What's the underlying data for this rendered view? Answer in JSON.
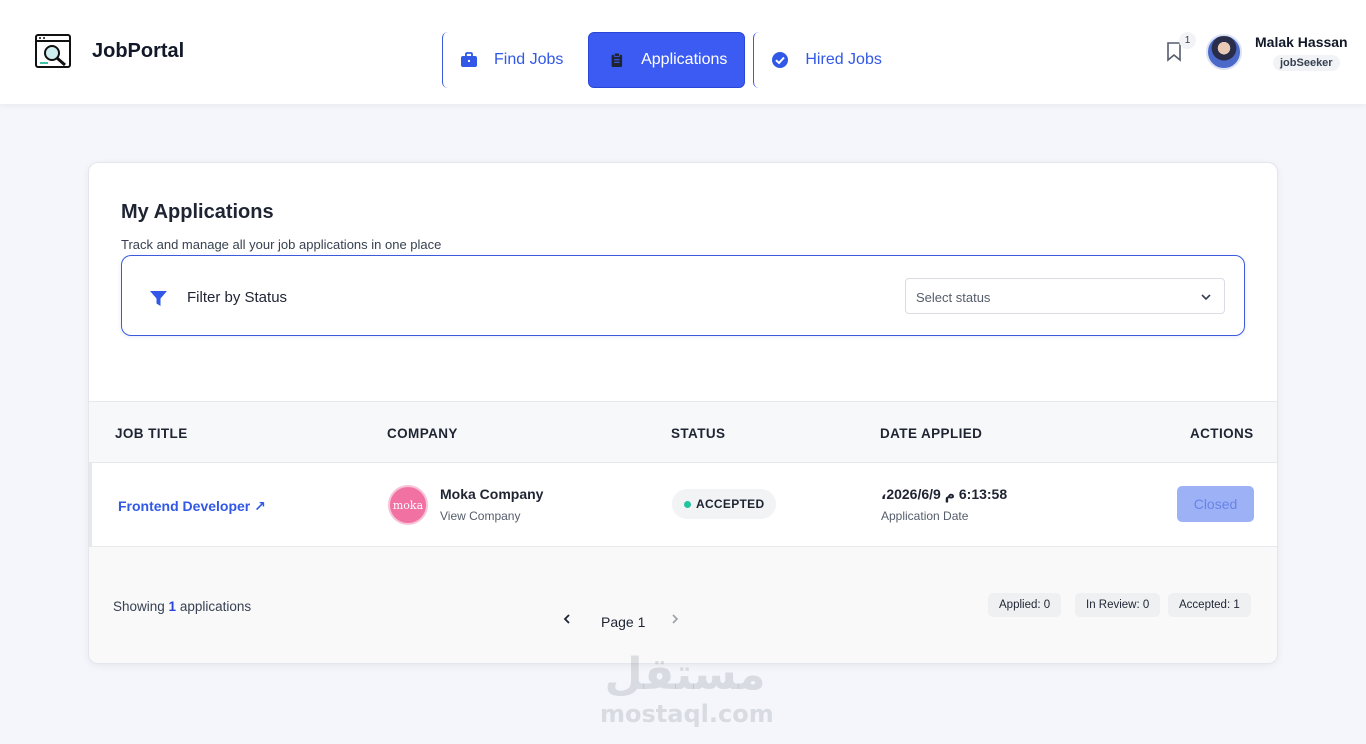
{
  "header": {
    "brand": "JobPortal",
    "nav": [
      {
        "label": "Find Jobs",
        "icon": "briefcase-icon"
      },
      {
        "label": "Applications",
        "icon": "clipboard-icon",
        "active": true
      },
      {
        "label": "Hired Jobs",
        "icon": "check-circle-icon"
      }
    ],
    "notification_count": "1",
    "user": {
      "name": "Malak Hassan",
      "role": "jobSeeker"
    }
  },
  "page": {
    "title": "My Applications",
    "subtitle": "Track and manage all your job applications in one place",
    "filter": {
      "label": "Filter by Status",
      "placeholder": "Select status"
    }
  },
  "table": {
    "columns": [
      "JOB TITLE",
      "COMPANY",
      "STATUS",
      "DATE APPLIED",
      "ACTIONS"
    ],
    "rows": [
      {
        "job_title": "Frontend Developer ↗",
        "company_logo_text": "moka",
        "company_name": "Moka Company",
        "company_link": "View Company",
        "status": "ACCEPTED",
        "date": "6:13:58 م‏ 2026/6/9،",
        "date_sub": "Application Date",
        "action": "Closed"
      }
    ]
  },
  "footer": {
    "showing_prefix": "Showing ",
    "showing_count": "1",
    "showing_suffix": " applications",
    "page_label": "Page 1",
    "stats": [
      "Applied: 0",
      "In Review: 0",
      "Accepted: 1"
    ]
  },
  "watermark": {
    "arabic": "مستقل",
    "latin": "mostaql.com"
  },
  "colors": {
    "accent": "#3b5bf2",
    "status_accepted": "#22c3a0",
    "brand_pink": "#f271a3"
  }
}
